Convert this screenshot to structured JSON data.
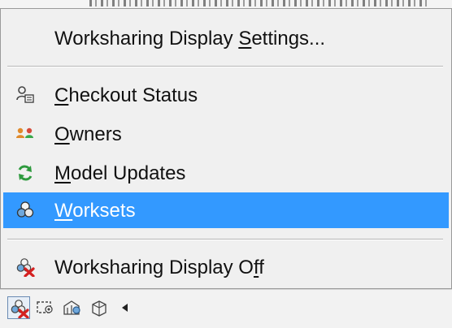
{
  "menu": {
    "items": [
      {
        "before": "Worksharing Display ",
        "ul": "S",
        "after": "ettings...",
        "icon": "none"
      },
      {
        "before": "",
        "ul": "C",
        "after": "heckout Status",
        "icon": "checkout-status-icon"
      },
      {
        "before": "",
        "ul": "O",
        "after": "wners",
        "icon": "owners-icon"
      },
      {
        "before": "",
        "ul": "M",
        "after": "odel Updates",
        "icon": "model-updates-icon"
      },
      {
        "before": "",
        "ul": "W",
        "after": "orksets",
        "icon": "worksets-icon"
      },
      {
        "before": "Worksharing Display O",
        "ul": "f",
        "after": "f",
        "icon": "worksharing-display-off-icon"
      }
    ],
    "highlighted_index": 4,
    "highlight_color": "#3399ff"
  },
  "statusbar": {
    "buttons": [
      "worksharing-display-off-icon",
      "temporary-hide-icon",
      "reveal-hidden-icon",
      "analytical-model-icon"
    ],
    "arrow": "left-arrow-icon"
  },
  "colors": {
    "menu_bg": "#f0f0f0",
    "separator": "#b7b7b7",
    "text": "#111111"
  }
}
